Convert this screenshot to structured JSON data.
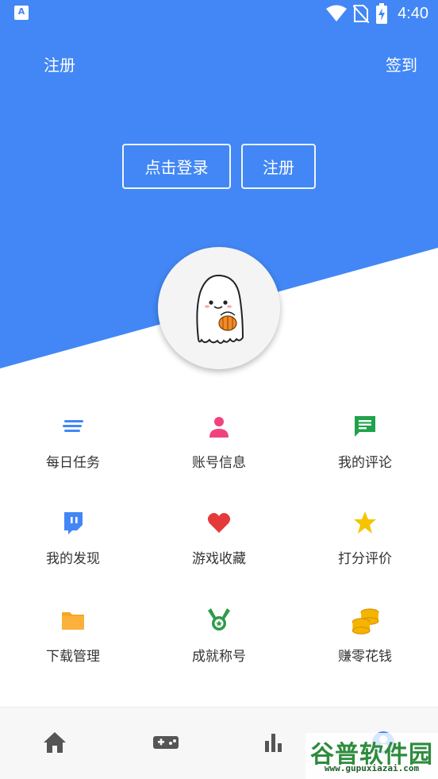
{
  "status_bar": {
    "time": "4:40",
    "app_icon_letter": "A"
  },
  "header": {
    "register_link": "注册",
    "signin_link": "签到"
  },
  "auth": {
    "login_button": "点击登录",
    "register_button": "注册"
  },
  "colors": {
    "brand_blue": "#4287f5",
    "text": "#333333",
    "nav_icon": "#555555"
  },
  "menu": [
    {
      "label": "每日任务",
      "icon": "list-lines-icon",
      "color": "#4287f5"
    },
    {
      "label": "账号信息",
      "icon": "person-icon",
      "color": "#f0437e"
    },
    {
      "label": "我的评论",
      "icon": "comment-icon",
      "color": "#1fa34a"
    },
    {
      "label": "我的发现",
      "icon": "twitch-icon",
      "color": "#4287f5"
    },
    {
      "label": "游戏收藏",
      "icon": "heart-icon",
      "color": "#e53a3a"
    },
    {
      "label": "打分评价",
      "icon": "star-icon",
      "color": "#f5c400"
    },
    {
      "label": "下载管理",
      "icon": "folder-icon",
      "color": "#f5a623"
    },
    {
      "label": "成就称号",
      "icon": "medal-icon",
      "color": "#2e9b4a"
    },
    {
      "label": "赚零花钱",
      "icon": "coins-icon",
      "color": "#f5b400"
    }
  ],
  "bottom_nav": [
    {
      "icon": "home-icon"
    },
    {
      "icon": "gamepad-icon"
    },
    {
      "icon": "bar-chart-icon"
    },
    {
      "icon": "profile-icon"
    }
  ],
  "watermark": {
    "title": "谷普软件园",
    "url": "www.gupuxiazai.com"
  }
}
